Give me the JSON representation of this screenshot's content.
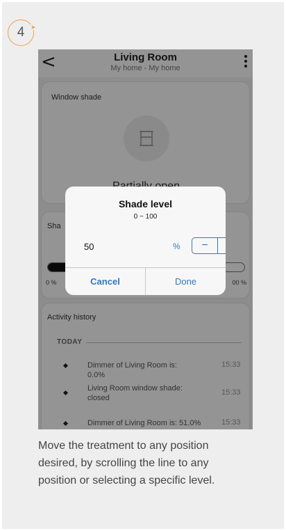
{
  "step": {
    "number": "4"
  },
  "header": {
    "back_icon": "chevron-left-icon",
    "title": "Living Room",
    "subtitle": "My home - My home",
    "more_icon": "vertical-dots-icon"
  },
  "shade_card": {
    "label": "Window shade",
    "icon": "window-shade-icon",
    "status": "Partially open"
  },
  "level_card": {
    "label": "Sha",
    "slider": {
      "min_label": "0 %",
      "max_label": "00 %",
      "level_percent": 50
    }
  },
  "history": {
    "title": "Activity history",
    "section": "TODAY",
    "items": [
      {
        "text": "Dimmer of Living Room is: 0.0%",
        "time": "15:33"
      },
      {
        "text": "Living Room window shade: closed",
        "time": "15:33"
      },
      {
        "text": "Dimmer of Living Room is: 51.0%",
        "time": "15:33"
      }
    ]
  },
  "dialog": {
    "title": "Shade level",
    "range": "0 ~ 100",
    "value": "50",
    "unit": "%",
    "minus": "−",
    "plus": "+",
    "cancel": "Cancel",
    "done": "Done"
  },
  "caption": "Move the treatment to any position desired, by scrolling the line to any position or selecting a specific level.",
  "colors": {
    "accent": "#2f78c4",
    "step_ring": "#f0a046",
    "background": "#eeeeee"
  }
}
